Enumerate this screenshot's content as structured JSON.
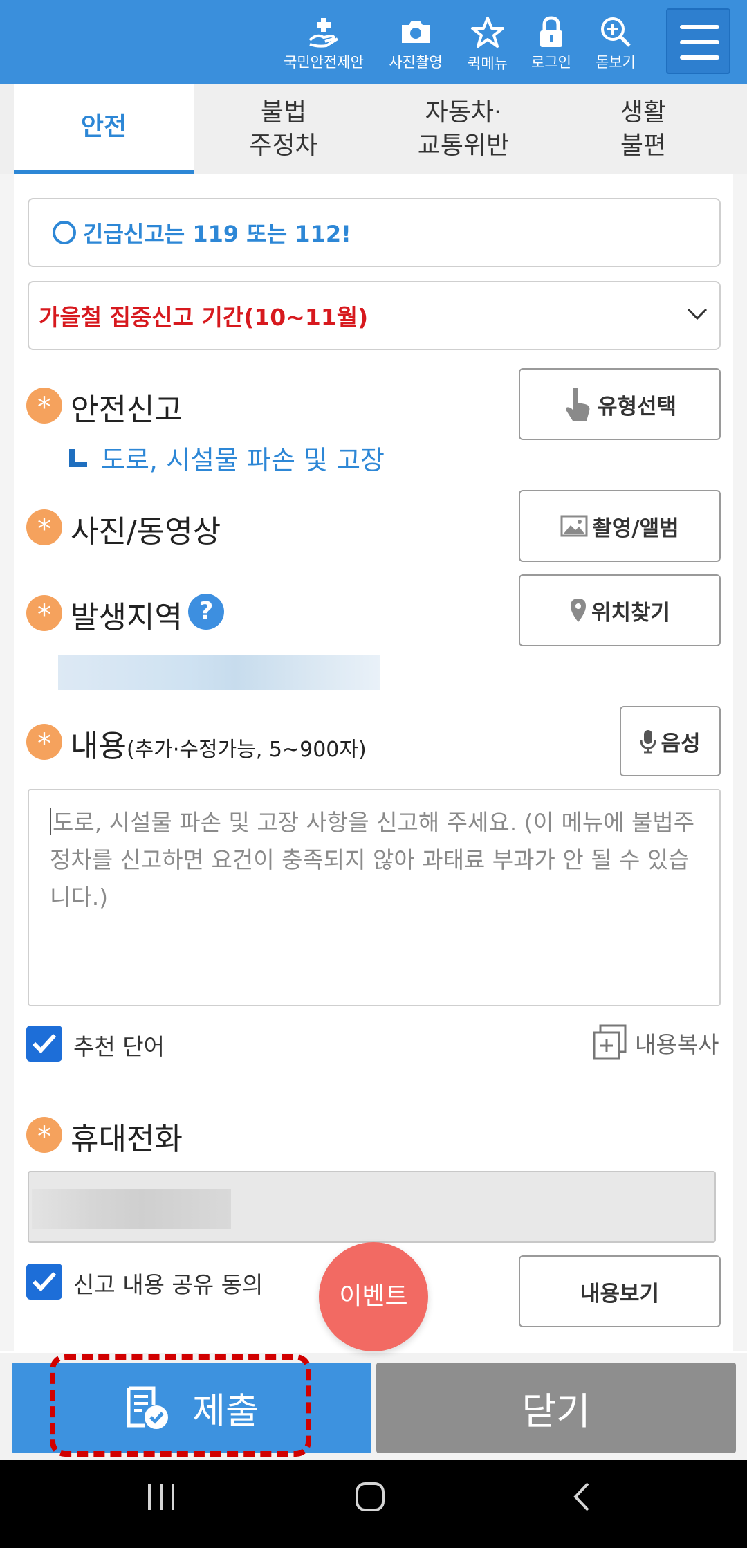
{
  "topbar": {
    "icons": [
      {
        "label": "국민안전제안",
        "icon": "hand-heart-icon"
      },
      {
        "label": "사진촬영",
        "icon": "camera-icon"
      },
      {
        "label": "퀵메뉴",
        "icon": "star-icon"
      },
      {
        "label": "로그인",
        "icon": "lock-icon"
      },
      {
        "label": "돋보기",
        "icon": "magnifier-plus-icon"
      }
    ],
    "menu_icon": "hamburger-icon",
    "color": "#3a8fdc"
  },
  "tabs": [
    {
      "label": "안전",
      "active": true
    },
    {
      "label": "불법\n주정차",
      "active": false
    },
    {
      "label": "자동차·\n교통위반",
      "active": false
    },
    {
      "label": "생활\n불편",
      "active": false
    }
  ],
  "notice": {
    "emergency": "긴급신고는 119 또는 112!",
    "campaign": "가을철 집중신고 기간(10~11월)"
  },
  "form": {
    "required_mark": "*",
    "report_type": {
      "label": "안전신고",
      "button": "유형선택",
      "selected": "도로, 시설물 파손 및 고장"
    },
    "media": {
      "label": "사진/동영상",
      "button": "촬영/앨범"
    },
    "location": {
      "label": "발생지역",
      "help": "?",
      "button": "위치찾기"
    },
    "content": {
      "label": "내용",
      "hint": "(추가·수정가능, 5~900자)",
      "button": "음성",
      "placeholder": "도로, 시설물 파손 및 고장 사항을 신고해 주세요. (이 메뉴에 불법주정차를 신고하면 요건이 충족되지 않아 과태료 부과가 안 될 수 있습니다.)"
    },
    "recommend": {
      "label": "추천 단어",
      "checked": true
    },
    "copy": "내용복사",
    "phone": {
      "label": "휴대전화"
    },
    "share": {
      "label": "신고 내용 공유 동의",
      "checked": true,
      "button": "내용보기"
    }
  },
  "event_badge": "이벤트",
  "actions": {
    "submit": "제출",
    "close": "닫기"
  },
  "colors": {
    "accent": "#3d92df",
    "required": "#f5a25d",
    "alert": "#d7191e",
    "close": "#8e8e8e",
    "event": "#f26a63"
  }
}
